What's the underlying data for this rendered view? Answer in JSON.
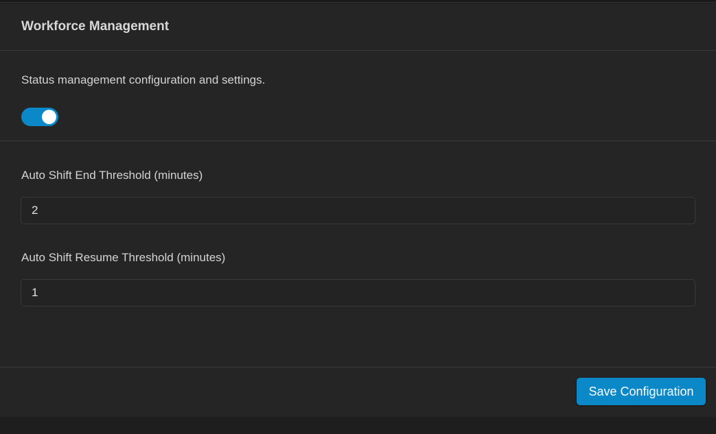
{
  "header": {
    "title": "Workforce Management"
  },
  "status": {
    "description": "Status management configuration and settings.",
    "toggle_enabled": true
  },
  "fields": [
    {
      "label": "Auto Shift End Threshold (minutes)",
      "value": "2"
    },
    {
      "label": "Auto Shift Resume Threshold (minutes)",
      "value": "1"
    }
  ],
  "footer": {
    "save_label": "Save Configuration"
  },
  "colors": {
    "accent": "#0a88c8",
    "card_background": "#252525",
    "page_background": "#1e1e1e"
  }
}
